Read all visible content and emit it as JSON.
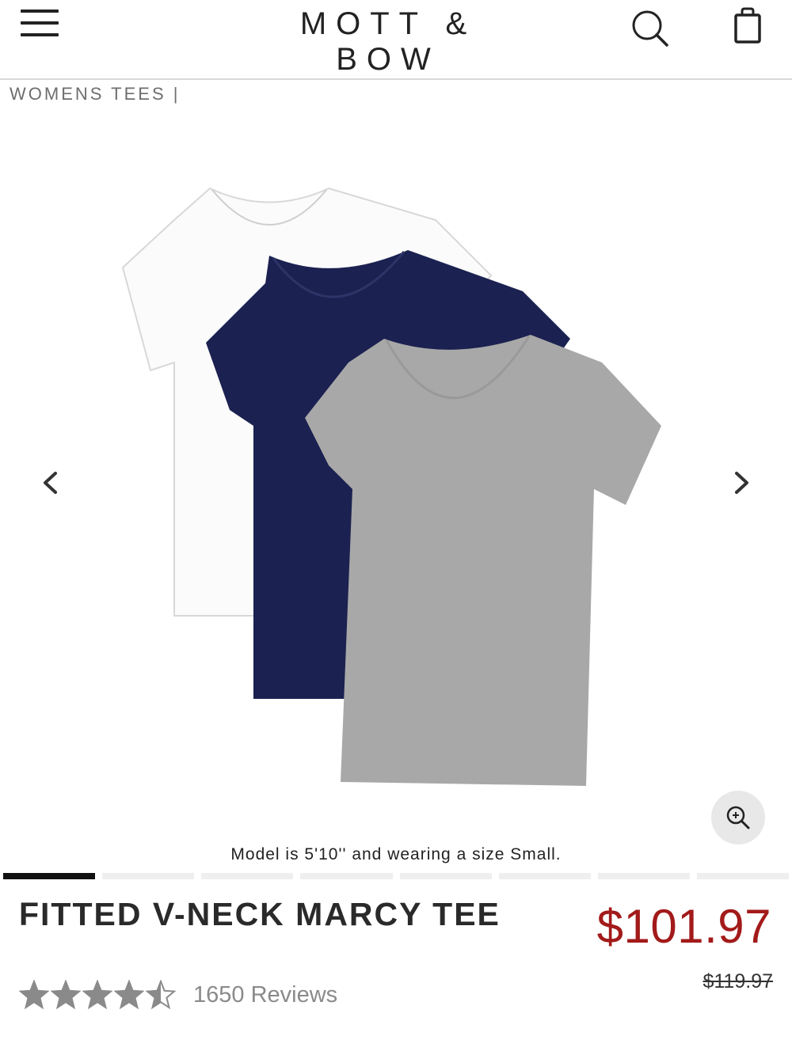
{
  "header": {
    "brand": "MOTT & BOW",
    "menu_icon": "hamburger-menu-icon",
    "search_icon": "search-icon",
    "bag_icon": "shopping-bag-icon"
  },
  "breadcrumb": "WOMENS TEES |",
  "gallery": {
    "model_note": "Model is 5'10'' and wearing a size Small.",
    "slide_count": 8,
    "active_slide": 1,
    "shirt_colors": [
      "#ffffff",
      "#1b2150",
      "#a8a8a8"
    ]
  },
  "product": {
    "title": "FITTED V-NECK MARCY TEE",
    "price": "$101.97",
    "old_price": "$119.97",
    "rating": 4.5,
    "rating_max": 5,
    "reviews": "1650 Reviews"
  },
  "colors": {
    "price": "#a31a1a",
    "star": "#8a8a8a"
  }
}
